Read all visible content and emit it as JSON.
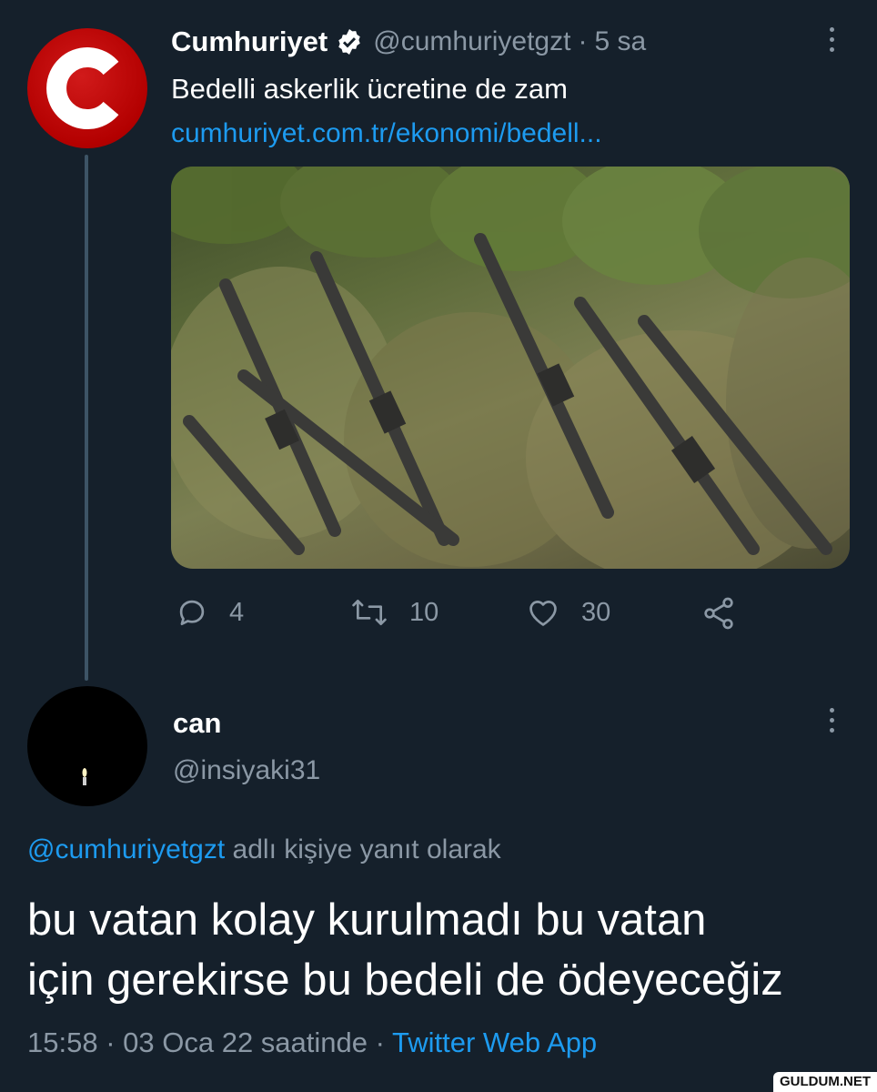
{
  "parent_tweet": {
    "author_name": "Cumhuriyet",
    "author_handle": "@cumhuriyetgzt",
    "separator": "·",
    "time_ago": "5 sa",
    "text": "Bedelli askerlik ücretine de zam",
    "link_text": "cumhuriyet.com.tr/ekonomi/bedell...",
    "avatar_letter": "C",
    "stats": {
      "replies": "4",
      "retweets": "10",
      "likes": "30"
    }
  },
  "reply_tweet": {
    "author_name": "can",
    "author_handle": "@insiyaki31",
    "replying_to_mention": "@cumhuriyetgzt",
    "replying_to_suffix": "adlı kişiye yanıt olarak",
    "text_line1": "bu vatan kolay kurulmadı bu vatan",
    "text_line2": "için gerekirse bu bedeli de ödeyeceğiz",
    "time": "15:58",
    "separator": "·",
    "date": "03 Oca 22 saatinde",
    "separator2": "·",
    "client": "Twitter Web App"
  },
  "watermark": "GULDUM.NET",
  "colors": {
    "background": "#15202b",
    "link": "#1d9bf0",
    "secondary_text": "#8b98a5",
    "verified_badge": "#ffffff",
    "avatar_red": "#b30000"
  },
  "icons": [
    "verified-badge-icon",
    "more-options-icon",
    "reply-icon",
    "retweet-icon",
    "like-icon",
    "share-icon",
    "candle-icon"
  ]
}
